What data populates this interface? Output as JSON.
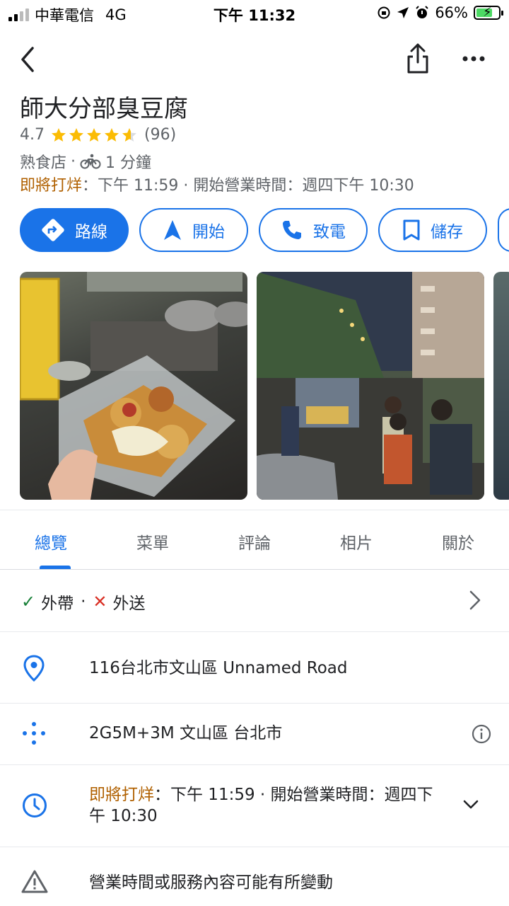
{
  "status_bar": {
    "carrier": "中華電信",
    "network": "4G",
    "time": "下午 11:32",
    "battery": "66%"
  },
  "place": {
    "name": "師大分部臭豆腐",
    "rating": "4.7",
    "rating_value": 4.7,
    "review_count": "(96)",
    "category": "熟食店",
    "separator": "·",
    "travel_time": "1 分鐘",
    "hours_status": "即將打烊",
    "hours_detail": "：下午 11:59 · 開始營業時間：週四下午 10:30"
  },
  "actions": {
    "directions": "路線",
    "start": "開始",
    "call": "致電",
    "save": "儲存"
  },
  "tabs": [
    "總覽",
    "菜單",
    "評論",
    "相片",
    "關於"
  ],
  "services": {
    "takeout": "外帶",
    "separator": "·",
    "delivery": "外送"
  },
  "details": {
    "address": "116台北市文山區 Unnamed Road",
    "plus_code": "2G5M+3M 文山區 台北市",
    "hours_status": "即將打烊",
    "hours_line1": "：下午 11:59 · 開始營業時間：週四下",
    "hours_line2": "午 10:30",
    "notice": "營業時間或服務內容可能有所變動"
  },
  "colors": {
    "accent": "#1a73e8",
    "star": "#fbbc04",
    "closing": "#b06000",
    "check": "#188038",
    "cross": "#d93025"
  }
}
